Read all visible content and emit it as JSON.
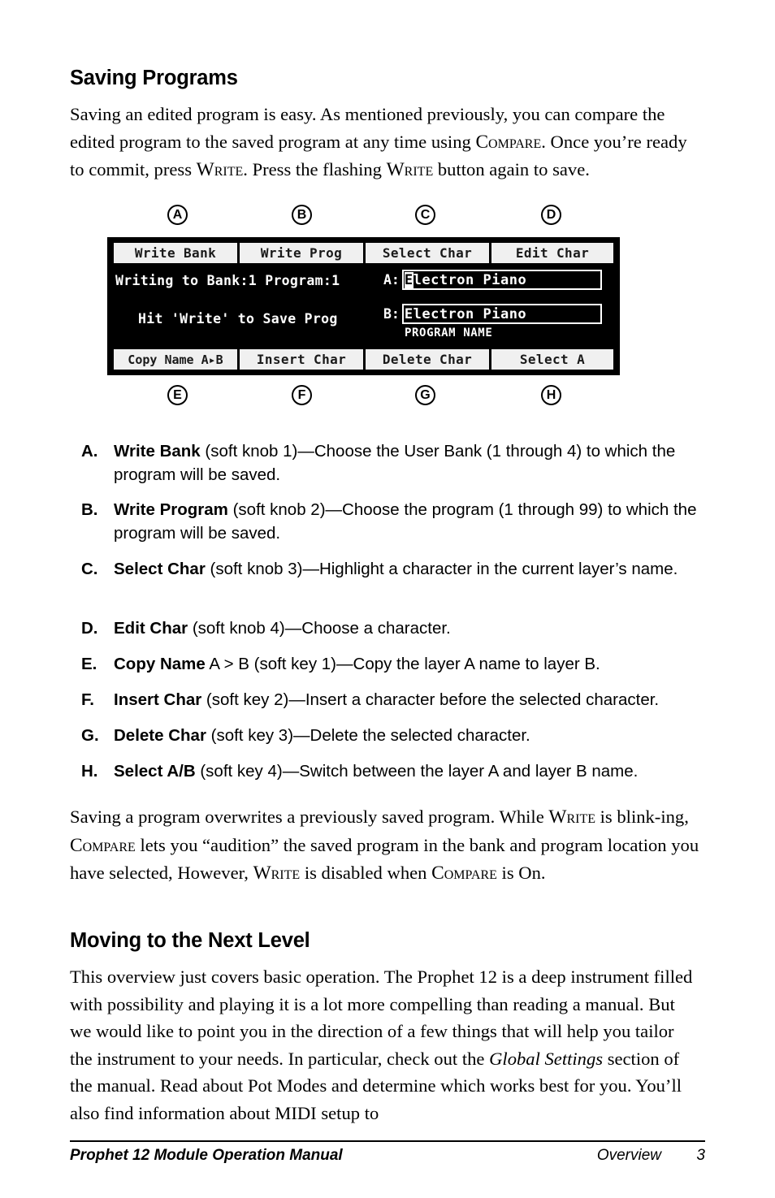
{
  "sections": {
    "saving_programs": {
      "heading": "Saving Programs",
      "intro_part1": "Saving an edited program is easy. As mentioned previously, you can compare the edited program to the saved program at any time using ",
      "intro_sc1": "Compare",
      "intro_part2": ". Once you’re ready to commit, press ",
      "intro_sc2": "Write",
      "intro_part3": ". Press the flashing ",
      "intro_sc3": "Write",
      "intro_part4": " button again to save.",
      "closing_part1": "Saving a program overwrites a previously saved program. While ",
      "closing_sc1": "Write",
      "closing_part2": " is blink-ing, ",
      "closing_sc2": "Compare",
      "closing_part3": " lets you “audition” the saved program in the bank and program location you have selected, However, ",
      "closing_sc3": "Write",
      "closing_part4": " is disabled when ",
      "closing_sc4": "Compare",
      "closing_part5": " is On."
    },
    "moving_next_level": {
      "heading": "Moving to the Next Level",
      "para_part1": "This overview just covers basic operation. The Prophet 12 is a deep instrument filled with possibility and playing it is a lot more compelling than reading a manual. But we would like to point you in the direction of a few things that will help you tailor the instrument to your needs. In particular, check out the ",
      "para_italic": "Global Settings",
      "para_part2": " section of the manual. Read about Pot Modes and determine which works best for you. You’ll also find information about MIDI setup to"
    }
  },
  "figure": {
    "callouts_top": [
      "A",
      "B",
      "C",
      "D"
    ],
    "callouts_bottom": [
      "E",
      "F",
      "G",
      "H"
    ],
    "lcd": {
      "soft_buttons_top": [
        "Write Bank",
        "Write Prog",
        "Select Char",
        "Edit Char"
      ],
      "soft_buttons_bottom": [
        "Copy Name A▸B",
        "Insert Char",
        "Delete Char",
        "Select A"
      ],
      "status_line_1": "Writing to Bank:1  Program:1",
      "status_line_2": "Hit 'Write' to Save Prog",
      "layer_a_label": "A:",
      "layer_a_selected_char": "E",
      "layer_a_name_rest": "lectron Piano",
      "layer_b_label": "B:",
      "layer_b_name": "Electron Piano",
      "program_name_caption": "PROGRAM NAME"
    }
  },
  "list": {
    "items": [
      {
        "marker": "A.",
        "bold": "Write Bank",
        "rest": " (soft knob 1)—Choose the User Bank (1 through 4) to which the program will be saved."
      },
      {
        "marker": "B.",
        "bold": "Write Program",
        "rest": " (soft knob 2)—Choose the program (1 through 99) to which the program will be saved."
      },
      {
        "marker": "C.",
        "bold": "Select Char",
        "rest": " (soft knob 3)—Highlight a character in the current layer’s name."
      },
      {
        "marker": "D.",
        "bold": "Edit Char",
        "rest": " (soft knob 4)—Choose a character."
      },
      {
        "marker": "E.",
        "bold": "Copy Name",
        "rest": " A > B (soft key 1)—Copy the layer A name to layer B."
      },
      {
        "marker": "F.",
        "bold": "Insert Char",
        "rest": " (soft key 2)—Insert a character before the selected character."
      },
      {
        "marker": "G.",
        "bold": "Delete Char",
        "rest": " (soft key 3)—Delete the selected character."
      },
      {
        "marker": "H.",
        "bold": "Select A/B",
        "rest": " (soft key 4)—Switch between the layer A and layer B name."
      }
    ]
  },
  "footer": {
    "manual_title": "Prophet 12 Module Operation Manual",
    "section_name": "Overview",
    "page_number": "3"
  }
}
